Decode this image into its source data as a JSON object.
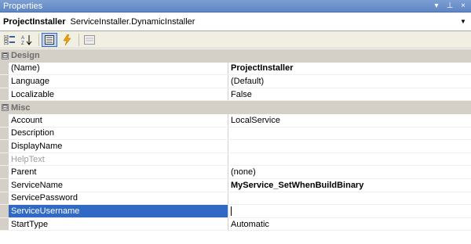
{
  "window": {
    "title": "Properties"
  },
  "title_buttons": {
    "dropdown": "▾",
    "pin": "⊥",
    "close": "×"
  },
  "object_selector": {
    "name": "ProjectInstaller",
    "type": "ServiceInstaller.DynamicInstaller"
  },
  "categories": {
    "design": {
      "label": "Design",
      "toggle": "⊟"
    },
    "misc": {
      "label": "Misc",
      "toggle": "⊟"
    }
  },
  "design_props": [
    {
      "name": "(Name)",
      "value": "ProjectInstaller"
    },
    {
      "name": "Language",
      "value": "(Default)"
    },
    {
      "name": "Localizable",
      "value": "False"
    }
  ],
  "misc_props": [
    {
      "name": "Account",
      "value": "LocalService"
    },
    {
      "name": "Description",
      "value": ""
    },
    {
      "name": "DisplayName",
      "value": ""
    },
    {
      "name": "HelpText",
      "value": ""
    },
    {
      "name": "Parent",
      "value": "(none)"
    },
    {
      "name": "ServiceName",
      "value": "MyService_SetWhenBuildBinary"
    },
    {
      "name": "ServicePassword",
      "value": ""
    },
    {
      "name": "ServiceUsername",
      "value": ""
    },
    {
      "name": "StartType",
      "value": "Automatic"
    }
  ],
  "colors": {
    "selection": "#316ac5",
    "category_bg": "#d4d0c8",
    "titlebar": "#6a8fc8"
  }
}
